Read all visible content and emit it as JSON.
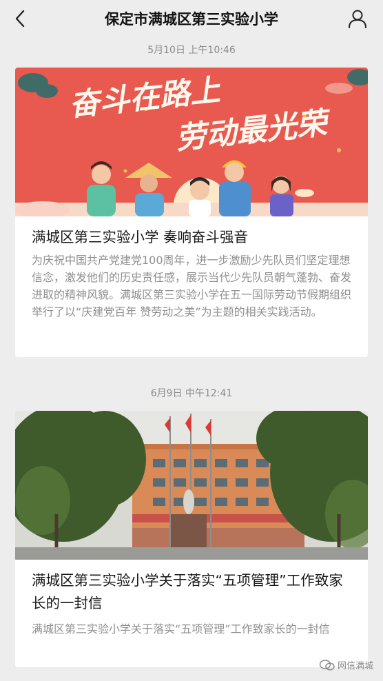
{
  "header": {
    "title": "保定市满城区第三实验小学"
  },
  "messages": [
    {
      "timestamp": "5月10日 上午10:46",
      "title": "满城区第三实验小学 奏响奋斗强音",
      "description": "为庆祝中国共产党建党100周年，进一步激励少先队员们坚定理想信念，激发他们的历史责任感，展示当代少先队员朝气蓬勃、奋发进取的精神风貌。满城区第三实验小学在五一国际劳动节假期组织举行了以“庆建党百年 赞劳动之美”为主题的相关实践活动。",
      "banner_text_1": "奋斗在路上",
      "banner_text_2": "劳动最光荣"
    },
    {
      "timestamp": "6月9日 中午12:41",
      "title": "满城区第三实验小学关于落实“五项管理”工作致家长的一封信",
      "description": "满城区第三实验小学关于落实“五项管理”工作致家长的一封信"
    }
  ],
  "watermark": {
    "text": "网信满城"
  },
  "colors": {
    "background": "#ededed",
    "banner_red": "#e8594f",
    "card": "#ffffff"
  }
}
